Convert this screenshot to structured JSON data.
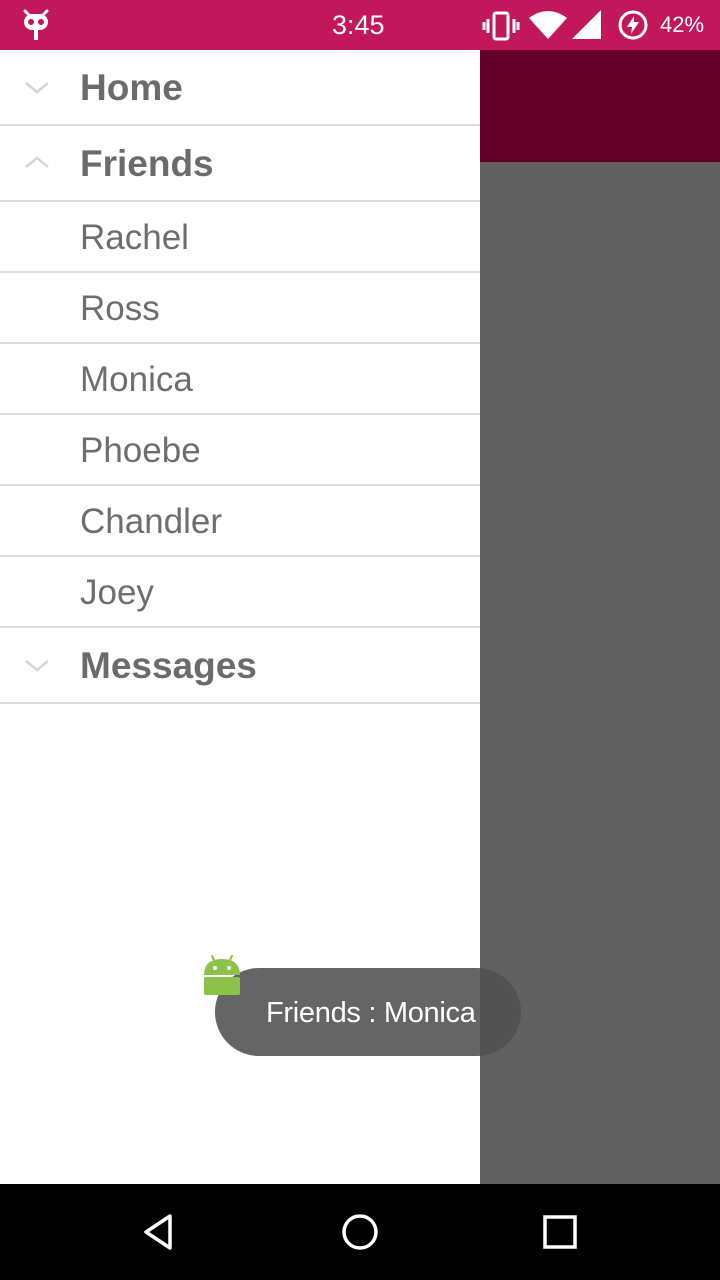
{
  "status_bar": {
    "time": "3:45",
    "battery": "42%",
    "color": "#c2185b",
    "icons": [
      "cyanogenmod-icon",
      "vibrate-icon",
      "wifi-icon",
      "signal-icon",
      "battery-charging-icon"
    ]
  },
  "drawer": {
    "groups": [
      {
        "label": "Home",
        "expanded": false
      },
      {
        "label": "Friends",
        "expanded": true,
        "children": [
          "Rachel",
          "Ross",
          "Monica",
          "Phoebe",
          "Chandler",
          "Joey"
        ]
      },
      {
        "label": "Messages",
        "expanded": false
      }
    ]
  },
  "toast": {
    "text": "Friends : Monica"
  },
  "nav_bar": {
    "buttons": [
      "back",
      "home",
      "recents"
    ]
  },
  "colors": {
    "primary": "#c2185b",
    "toolbar_dimmed": "#640027",
    "scrim_content": "#616161"
  }
}
